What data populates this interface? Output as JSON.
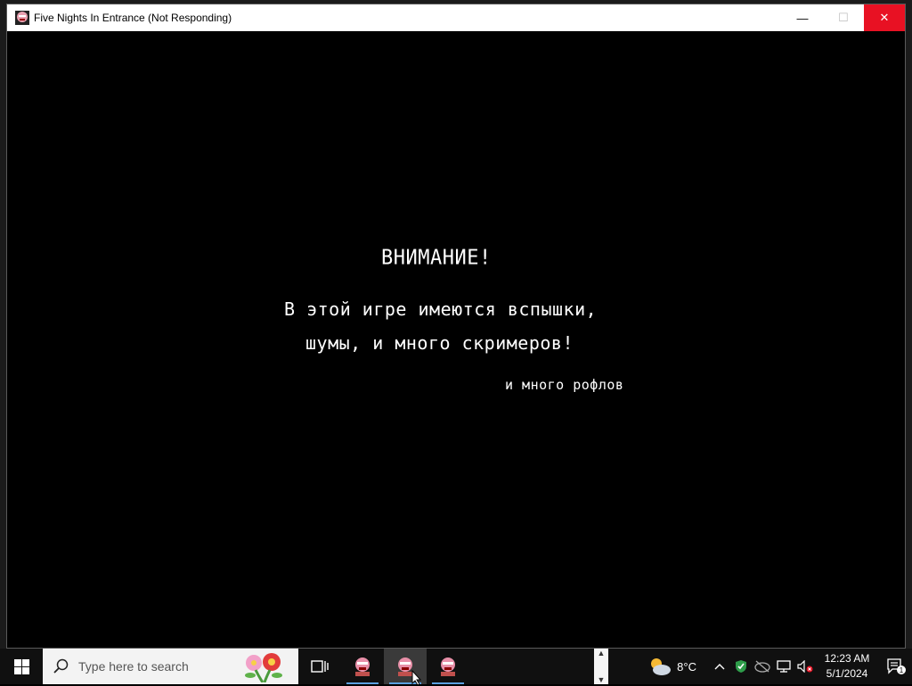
{
  "window": {
    "title": "Five Nights In Entrance (Not Responding)",
    "minimize_glyph": "—",
    "maximize_glyph": "☐",
    "close_glyph": "✕"
  },
  "game": {
    "warning_title": "ВНИМАНИЕ!",
    "warning_line1": "В этой игре имеются вспышки,",
    "warning_line2": "шумы, и много скримеров!",
    "warning_note": "и много рофлов"
  },
  "taskbar": {
    "search_placeholder": "Type here to search",
    "weather_temp": "8°C",
    "time": "12:23 AM",
    "date": "5/1/2024",
    "notification_count": "1",
    "running_apps": [
      "Five Nights In Entrance",
      "Five Nights In Entrance",
      "Five Nights In Entrance"
    ]
  },
  "colors": {
    "close_button": "#e81123",
    "taskbar": "#101010",
    "active_underline": "#5aa0e0"
  }
}
